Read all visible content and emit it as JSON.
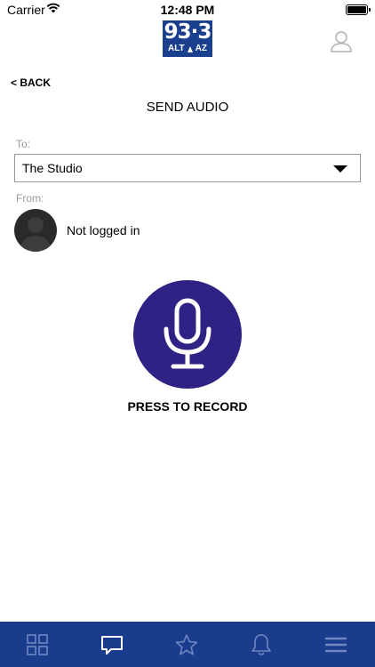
{
  "status_bar": {
    "carrier": "Carrier",
    "time": "12:48 PM"
  },
  "header": {
    "logo_number": "93·3",
    "logo_left": "ALT",
    "logo_right": "AZ",
    "brand_color": "#1a3f8f"
  },
  "nav": {
    "back_label": "< BACK",
    "page_title": "SEND AUDIO"
  },
  "form": {
    "to_label": "To:",
    "to_value": "The Studio",
    "from_label": "From:",
    "from_name": "Not logged in"
  },
  "record": {
    "label": "PRESS TO RECORD",
    "button_color": "#2e2384"
  },
  "tab_bar": {
    "background": "#1a3c8c",
    "tabs": [
      {
        "icon": "grid-icon",
        "active": false
      },
      {
        "icon": "chat-icon",
        "active": true
      },
      {
        "icon": "star-icon",
        "active": false
      },
      {
        "icon": "bell-icon",
        "active": false
      },
      {
        "icon": "menu-icon",
        "active": false
      }
    ]
  }
}
